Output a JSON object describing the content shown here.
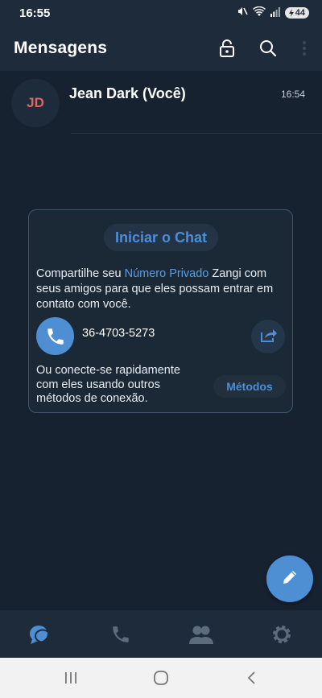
{
  "status_bar": {
    "time": "16:55",
    "battery": "44",
    "icons": [
      "mute-icon",
      "wifi-icon",
      "signal-icon",
      "battery-icon"
    ]
  },
  "app_bar": {
    "title": "Mensagens",
    "icons": [
      "lock-icon",
      "search-icon",
      "more-vert-icon"
    ]
  },
  "chat": {
    "avatar_initials": "JD",
    "name": "Jean Dark (Você)",
    "time": "16:54"
  },
  "card": {
    "start_chat_label": "Iniciar o Chat",
    "share_prefix": "Compartilhe seu ",
    "share_link": "Número Privado",
    "share_suffix": " Zangi com seus amigos para que eles possam entrar em contato com você.",
    "phone_number": "36-4703-5273",
    "connect_text": "Ou conecte-se rapidamente com eles usando outros métodos de conexão.",
    "methods_label": "Métodos"
  },
  "bottom_nav": {
    "items": [
      "chats-icon",
      "calls-icon",
      "contacts-icon",
      "settings-icon"
    ],
    "active": "chats-icon"
  },
  "colors": {
    "accent": "#4e8fd3",
    "background": "#172230",
    "bar": "#1e2b3a",
    "avatar_text": "#e2665f"
  }
}
